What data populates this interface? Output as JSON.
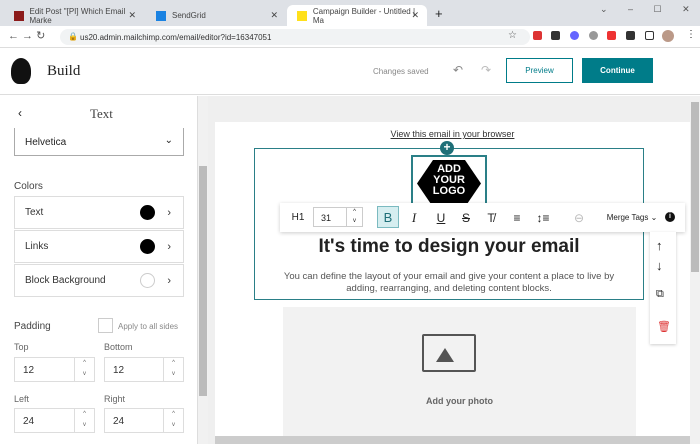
{
  "browser": {
    "tabs": [
      {
        "label": "Edit Post \"[PI] Which Email Marke",
        "favicon_color": "#8b1a1a"
      },
      {
        "label": "SendGrid",
        "favicon_color": "#1a82e2"
      },
      {
        "label": "Campaign Builder - Untitled | Ma",
        "favicon_color": "#ffe01b"
      }
    ],
    "url": "us20.admin.mailchimp.com/email/editor?id=16347051"
  },
  "header": {
    "title": "Build",
    "status": "Changes saved",
    "preview": "Preview",
    "continue": "Continue",
    "accent": "#007c89"
  },
  "panel": {
    "title": "Text",
    "font": "Helvetica",
    "colors_heading": "Colors",
    "colors": [
      {
        "label": "Text",
        "value": "#000000"
      },
      {
        "label": "Links",
        "value": "#000000"
      },
      {
        "label": "Block Background",
        "value": "transparent"
      }
    ],
    "padding_heading": "Padding",
    "apply_all": "Apply to all sides",
    "fields": [
      {
        "label": "Top",
        "value": "12"
      },
      {
        "label": "Bottom",
        "value": "12"
      },
      {
        "label": "Left",
        "value": "24"
      },
      {
        "label": "Right",
        "value": "24"
      }
    ]
  },
  "email": {
    "view_link": "View this email in your browser",
    "logo": [
      "ADD",
      "YOUR",
      "LOGO"
    ],
    "heading": "It's time to design your email",
    "body": "You can define the layout of your email and give your content a place to live by adding, rearranging, and deleting content blocks.",
    "photo": "Add your photo"
  },
  "toolbar": {
    "style": "H1",
    "size": "31",
    "merge_tags": "Merge Tags"
  }
}
